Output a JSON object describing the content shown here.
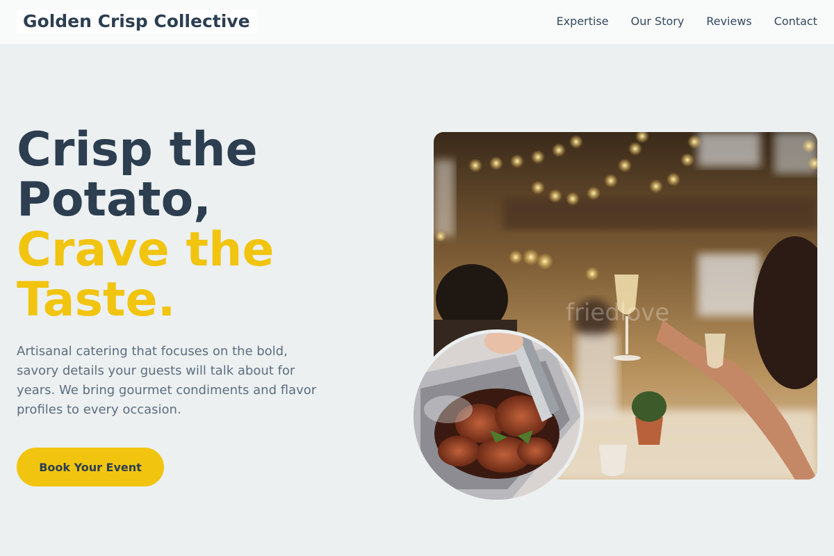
{
  "header": {
    "brand": "Golden Crisp Collective",
    "nav": [
      {
        "label": "Expertise"
      },
      {
        "label": "Our Story"
      },
      {
        "label": "Reviews"
      },
      {
        "label": "Contact"
      }
    ]
  },
  "hero": {
    "title_line1": "Crisp the",
    "title_line2": "Potato,",
    "title_line3": "Crave the",
    "title_line4": "Taste.",
    "description": "Artisanal catering that focuses on the bold, savory details your guests will talk about for years. We bring gourmet condiments and flavor profiles to every occasion.",
    "cta_label": "Book Your Event"
  },
  "images": {
    "main_photo_alt": "Guests raising champagne glasses at a festive dinner under string lights",
    "main_photo_watermark": "friedlove",
    "circle_photo_alt": "Tongs serving grilled chicken from a catering tray"
  },
  "colors": {
    "primary": "#2c3e50",
    "accent": "#f1c40f",
    "background": "#ecf0f1",
    "text_muted": "#5d6d7e"
  }
}
